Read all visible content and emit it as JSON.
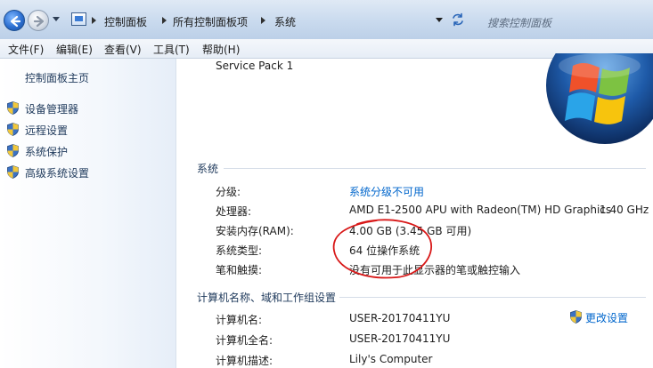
{
  "address_bar": {
    "breadcrumbs": [
      "控制面板",
      "所有控制面板项",
      "系统"
    ],
    "search_placeholder": "搜索控制面板"
  },
  "menubar": [
    {
      "label": "文件(F)"
    },
    {
      "label": "编辑(E)"
    },
    {
      "label": "查看(V)"
    },
    {
      "label": "工具(T)"
    },
    {
      "label": "帮助(H)"
    }
  ],
  "sidebar": {
    "home": "控制面板主页",
    "links": [
      {
        "label": "设备管理器",
        "icon": "shield-icon"
      },
      {
        "label": "远程设置",
        "icon": "shield-icon"
      },
      {
        "label": "系统保护",
        "icon": "shield-icon"
      },
      {
        "label": "高级系统设置",
        "icon": "shield-icon"
      }
    ]
  },
  "main": {
    "service_pack": "Service Pack 1",
    "system": {
      "title": "系统",
      "rows": [
        {
          "label": "分级:",
          "value": "系统分级不可用",
          "is_link": true
        },
        {
          "label": "处理器:",
          "value": "AMD E1-2500 APU with Radeon(TM) HD Graphics",
          "extra": "1.40 GHz"
        },
        {
          "label": "安装内存(RAM):",
          "value": "4.00 GB (3.45 GB 可用)"
        },
        {
          "label": "系统类型:",
          "value": "64 位操作系统"
        },
        {
          "label": "笔和触摸:",
          "value": "没有可用于此显示器的笔或触控输入"
        }
      ]
    },
    "computer": {
      "title": "计算机名称、域和工作组设置",
      "change_label": "更改设置",
      "rows": [
        {
          "label": "计算机名:",
          "value": "USER-20170411YU"
        },
        {
          "label": "计算机全名:",
          "value": "USER-20170411YU"
        },
        {
          "label": "计算机描述:",
          "value": "Lily's Computer"
        }
      ]
    }
  },
  "colors": {
    "link": "#0066cc",
    "section_title": "#1e395b",
    "annotation": "#d81818"
  }
}
